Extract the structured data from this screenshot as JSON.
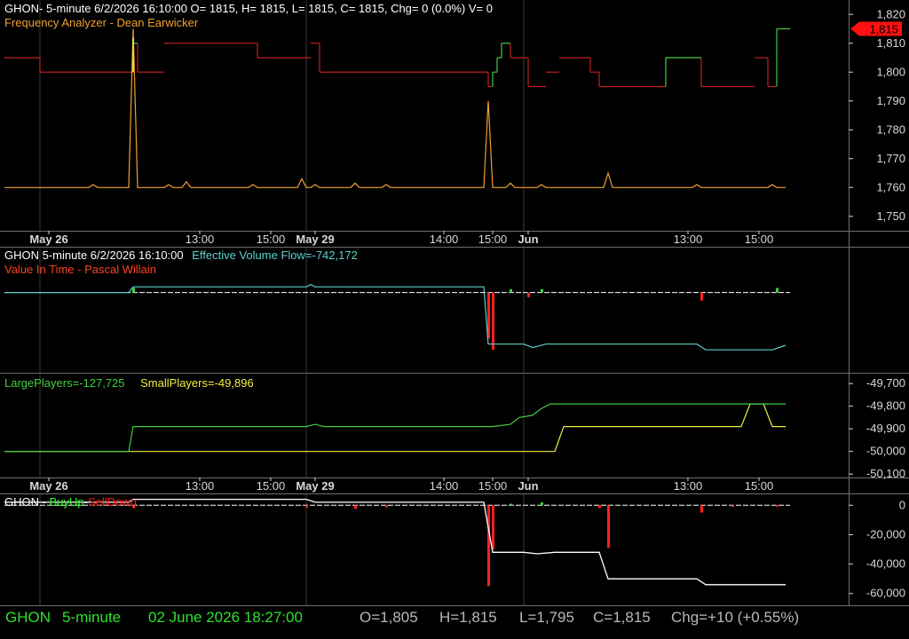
{
  "colors": {
    "background": "#000000",
    "grid": "#3a3a3a",
    "divider": "#6e6e6e",
    "axis_text": "#d8d8d8",
    "white": "#ffffff",
    "title_orange": "#f0a030",
    "title_red": "#ff4020",
    "cyan": "#5fd0c8",
    "green": "#40d040",
    "yellow": "#f0f040",
    "red": "#ff2020",
    "darkred": "#c02020",
    "bright_green": "#30ff30",
    "last_price_bg": "#ff1010"
  },
  "panes": {
    "price": {
      "header_line1": "GHON- 5-minute 6/2/2026 16:10:00 O= 1815, H= 1815, L= 1815, C= 1815, Chg= 0 (0.0%) V= 0",
      "header_line2": "Frequency Analyzer - Dean Earwicker",
      "last_price_label": "1,815"
    },
    "vit": {
      "header_prefix": "GHON 5-minute  6/2/2026 16:10:00",
      "header_evf": "Effective Volume Flow=-742,172",
      "header_line2": "Value In Time - Pascal Willain"
    },
    "players": {
      "large_label": "LargePlayers=-127,725",
      "small_label": "SmallPlayers=-49,896"
    },
    "buysell": {
      "label_ghon": "GHON - ",
      "label_buyup": "BuyUp",
      "label_dash": "-",
      "label_selldown": "SellDown"
    }
  },
  "x_axis_labels": [
    {
      "text": "May 26",
      "bold": true,
      "idx": 10
    },
    {
      "text": "13:00",
      "bold": false,
      "idx": 44
    },
    {
      "text": "15:00",
      "bold": false,
      "idx": 60
    },
    {
      "text": "May 29",
      "bold": true,
      "idx": 70
    },
    {
      "text": "14:00",
      "bold": false,
      "idx": 99
    },
    {
      "text": "15:00",
      "bold": false,
      "idx": 110
    },
    {
      "text": "Jun",
      "bold": true,
      "idx": 118
    },
    {
      "text": "13:00",
      "bold": false,
      "idx": 154
    },
    {
      "text": "15:00",
      "bold": false,
      "idx": 170
    }
  ],
  "status_bar": {
    "symbol": "GHON",
    "interval": "5-minute",
    "datetime": "02 June 2026 18:27:00",
    "open": "O=1,805",
    "high": "H=1,815",
    "low": "L=1,795",
    "close": "C=1,815",
    "change": "Chg=+10 (+0.55%)"
  },
  "chart_data": [
    {
      "type": "line",
      "x_count": 177,
      "ylim": [
        1745,
        1825
      ],
      "yticks": [
        1750,
        1760,
        1770,
        1780,
        1790,
        1800,
        1810,
        1820
      ],
      "ytick_labels": [
        "1,750",
        "1,760",
        "1,770",
        "1,780",
        "1,790",
        "1,800",
        "1,810",
        "1,820"
      ],
      "price_segments": [
        {
          "from": 0,
          "to": 7,
          "value": 1805,
          "dir": "down"
        },
        {
          "from": 8,
          "to": 14,
          "value": 1800,
          "dir": "down"
        },
        {
          "from": 15,
          "to": 28,
          "value": 1800,
          "dir": "down"
        },
        {
          "from": 29,
          "to": 29,
          "value": 1810,
          "dir": "up"
        },
        {
          "from": 30,
          "to": 35,
          "value": 1800,
          "dir": "down"
        },
        {
          "from": 36,
          "to": 56,
          "value": 1810,
          "dir": "down"
        },
        {
          "from": 57,
          "to": 68,
          "value": 1805,
          "dir": "down"
        },
        {
          "from": 69,
          "to": 70,
          "value": 1810,
          "dir": "down"
        },
        {
          "from": 71,
          "to": 108,
          "value": 1800,
          "dir": "down"
        },
        {
          "from": 109,
          "to": 109,
          "value": 1795,
          "dir": "down"
        },
        {
          "from": 110,
          "to": 110,
          "value": 1800,
          "dir": "up"
        },
        {
          "from": 111,
          "to": 111,
          "value": 1805,
          "dir": "up"
        },
        {
          "from": 112,
          "to": 113,
          "value": 1810,
          "dir": "up"
        },
        {
          "from": 114,
          "to": 117,
          "value": 1805,
          "dir": "down"
        },
        {
          "from": 118,
          "to": 121,
          "value": 1795,
          "dir": "down"
        },
        {
          "from": 122,
          "to": 124,
          "value": 1800,
          "dir": "down"
        },
        {
          "from": 125,
          "to": 131,
          "value": 1805,
          "dir": "down"
        },
        {
          "from": 132,
          "to": 133,
          "value": 1800,
          "dir": "down"
        },
        {
          "from": 134,
          "to": 148,
          "value": 1795,
          "dir": "down"
        },
        {
          "from": 149,
          "to": 156,
          "value": 1805,
          "dir": "up"
        },
        {
          "from": 157,
          "to": 168,
          "value": 1795,
          "dir": "down"
        },
        {
          "from": 169,
          "to": 171,
          "value": 1805,
          "dir": "down"
        },
        {
          "from": 172,
          "to": 173,
          "value": 1795,
          "dir": "down"
        },
        {
          "from": 174,
          "to": 176,
          "value": 1815,
          "dir": "up"
        }
      ],
      "frequency_base": 1760,
      "frequency_spikes": [
        [
          20,
          1761
        ],
        [
          29,
          1815
        ],
        [
          37,
          1761
        ],
        [
          41,
          1762
        ],
        [
          56,
          1761
        ],
        [
          67,
          1763
        ],
        [
          70,
          1761
        ],
        [
          79,
          1761.5
        ],
        [
          86,
          1761
        ],
        [
          109,
          1790
        ],
        [
          114,
          1761.5
        ],
        [
          121,
          1761
        ],
        [
          136,
          1765
        ],
        [
          156,
          1761
        ],
        [
          173,
          1761
        ]
      ]
    },
    {
      "type": "line",
      "x_count": 177,
      "ylim": [
        -7,
        4
      ],
      "zero": 0,
      "evf_points": [
        [
          0,
          0
        ],
        [
          28,
          0
        ],
        [
          29,
          0.5
        ],
        [
          68,
          0.5
        ],
        [
          69,
          0.7
        ],
        [
          70,
          0.5
        ],
        [
          108,
          0.5
        ],
        [
          109,
          -4.5
        ],
        [
          110,
          -4.5
        ],
        [
          117,
          -4.5
        ],
        [
          119,
          -4.8
        ],
        [
          122,
          -4.5
        ],
        [
          156,
          -4.5
        ],
        [
          158,
          -5
        ],
        [
          173,
          -5
        ],
        [
          176,
          -4.6
        ]
      ],
      "vit_bars": [
        [
          29,
          0.4
        ],
        [
          109,
          -4
        ],
        [
          110,
          -5
        ],
        [
          114,
          0.3
        ],
        [
          118,
          -0.4
        ],
        [
          121,
          0.3
        ],
        [
          157,
          -0.7
        ],
        [
          174,
          0.4
        ]
      ]
    },
    {
      "type": "line",
      "x_count": 177,
      "ylim": [
        -50115,
        -49660
      ],
      "yticks": [
        -50100,
        -50000,
        -49900,
        -49800,
        -49700
      ],
      "ytick_labels": [
        "-50,100",
        "-50,000",
        "-49,900",
        "-49,800",
        "-49,700"
      ],
      "large_players": [
        [
          0,
          -50000
        ],
        [
          28,
          -50000
        ],
        [
          29,
          -49890
        ],
        [
          68,
          -49890
        ],
        [
          70,
          -49880
        ],
        [
          72,
          -49890
        ],
        [
          110,
          -49890
        ],
        [
          114,
          -49880
        ],
        [
          116,
          -49850
        ],
        [
          119,
          -49840
        ],
        [
          121,
          -49810
        ],
        [
          123,
          -49790
        ],
        [
          176,
          -49790
        ]
      ],
      "small_players": [
        [
          0,
          -50000
        ],
        [
          124,
          -50000
        ],
        [
          126,
          -49890
        ],
        [
          166,
          -49890
        ],
        [
          168,
          -49790
        ],
        [
          171,
          -49790
        ],
        [
          173,
          -49890
        ],
        [
          176,
          -49890
        ]
      ]
    },
    {
      "type": "line",
      "x_count": 177,
      "ylim": [
        -68000,
        8000
      ],
      "yticks": [
        -60000,
        -40000,
        -20000,
        0
      ],
      "ytick_labels": [
        "-60,000",
        "-40,000",
        "-20,000",
        "0"
      ],
      "buyup_line": [
        [
          0,
          2000
        ],
        [
          28,
          2000
        ],
        [
          29,
          4000
        ],
        [
          68,
          4000
        ],
        [
          70,
          2000
        ],
        [
          108,
          2000
        ],
        [
          109,
          -15000
        ],
        [
          110,
          -32000
        ],
        [
          117,
          -32000
        ],
        [
          120,
          -33000
        ],
        [
          124,
          -32000
        ],
        [
          134,
          -32000
        ],
        [
          136,
          -50000
        ],
        [
          156,
          -50000
        ],
        [
          158,
          -54000
        ],
        [
          176,
          -54000
        ]
      ],
      "buysell_bars": [
        [
          29,
          -2000
        ],
        [
          68,
          -1500
        ],
        [
          79,
          -2500
        ],
        [
          86,
          -1500
        ],
        [
          109,
          -55000
        ],
        [
          110,
          -30000
        ],
        [
          114,
          1000
        ],
        [
          121,
          2000
        ],
        [
          134,
          -2000
        ],
        [
          136,
          -29000
        ],
        [
          157,
          -5000
        ],
        [
          164,
          -1000
        ],
        [
          174,
          -1000
        ]
      ]
    }
  ]
}
